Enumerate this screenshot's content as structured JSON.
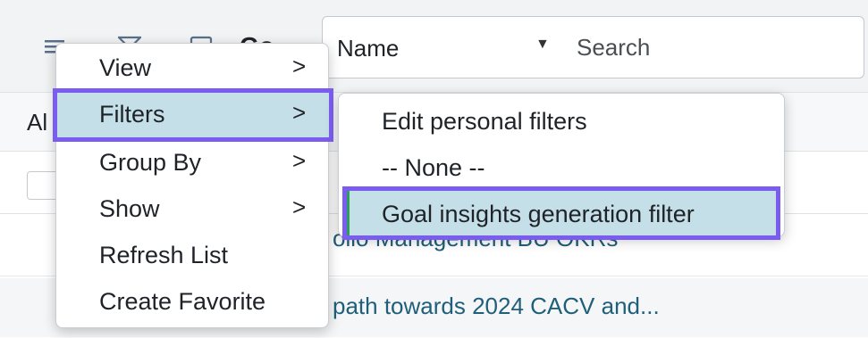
{
  "toolbar": {
    "icons": [
      "hamburger-menu-icon",
      "filter-funnel-icon",
      "window-icon"
    ],
    "title_partial": "Go",
    "field_select": {
      "value": "Name"
    },
    "search": {
      "placeholder": "Search"
    }
  },
  "subheader": {
    "text_partial": "Al"
  },
  "rows": [
    {
      "text": "olio Management BU OKRs"
    },
    {
      "text": "path towards 2024 CACV and..."
    }
  ],
  "context_menu": {
    "items": [
      {
        "label": "View",
        "has_submenu": true
      },
      {
        "label": "Filters",
        "has_submenu": true,
        "active": true
      },
      {
        "label": "Group By",
        "has_submenu": true
      },
      {
        "label": "Show",
        "has_submenu": true
      },
      {
        "label": "Refresh List",
        "has_submenu": false
      },
      {
        "label": "Create Favorite",
        "has_submenu": false
      }
    ],
    "chevron": ">"
  },
  "filters_submenu": {
    "items": [
      {
        "label": "Edit personal filters"
      },
      {
        "label": "-- None --"
      },
      {
        "label": "Goal insights generation filter",
        "selected": true
      }
    ]
  },
  "colors": {
    "highlight_bg": "#c5dfe9",
    "focus_outline": "#7b5cf0",
    "selected_marker": "#2e9e5b",
    "link": "#1f5f7a"
  }
}
